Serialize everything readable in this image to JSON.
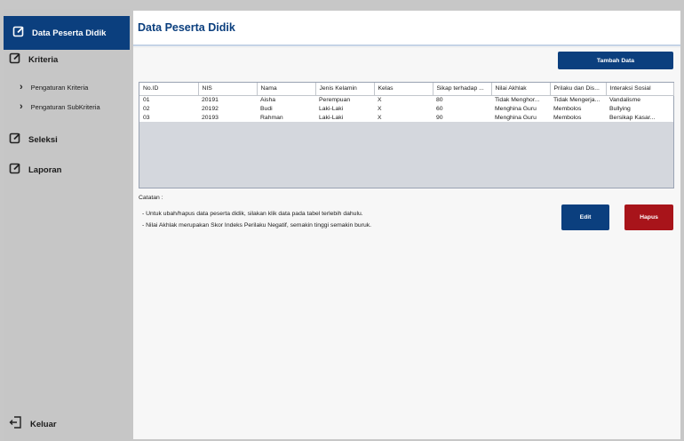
{
  "sidebar": {
    "items": [
      {
        "label": "Data Peserta Didik",
        "icon": "edit-icon"
      },
      {
        "label": "Kriteria",
        "icon": "edit-icon"
      },
      {
        "label": "Pengaturan Kriteria",
        "icon": "chevron-right-icon"
      },
      {
        "label": "Pengaturan SubKriteria",
        "icon": "chevron-right-icon"
      },
      {
        "label": "Seleksi",
        "icon": "edit-icon"
      },
      {
        "label": "Laporan",
        "icon": "edit-icon"
      }
    ],
    "logout_label": "Keluar"
  },
  "header": {
    "title": "Data Peserta Didik"
  },
  "toolbar": {
    "add_label": "Tambah Data",
    "edit_label": "Edit",
    "delete_label": "Hapus"
  },
  "table": {
    "columns": [
      "No.ID",
      "NIS",
      "Nama",
      "Jenis Kelamin",
      "Kelas",
      "Sikap terhadap ...",
      "Nilai Akhlak",
      "Prilaku dan Dis...",
      "Interaksi Sosial"
    ],
    "rows": [
      [
        "01",
        "20191",
        "Aisha",
        "Perempuan",
        "X",
        "80",
        "Tidak Menghor...",
        "Tidak Mengerja...",
        "Vandalisme"
      ],
      [
        "02",
        "20192",
        "Budi",
        "Laki-Laki",
        "X",
        "60",
        "Menghina Guru",
        "Membolos",
        "Bullying"
      ],
      [
        "03",
        "20193",
        "Rahman",
        "Laki-Laki",
        "X",
        "90",
        "Menghina Guru",
        "Membolos",
        "Bersikap Kasar..."
      ]
    ]
  },
  "notes": {
    "heading": "Catatan :",
    "lines": [
      "- Untuk ubah/hapus data peserta didik, silakan klik data pada tabel terlebih dahulu.",
      "- Nilai Akhlak merupakan Skor Indeks Perilaku Negatif, semakin tinggi semakin buruk."
    ]
  },
  "colors": {
    "primary": "#0b3f7e",
    "danger": "#a8141a",
    "sidebar": "#c6c6c6"
  }
}
